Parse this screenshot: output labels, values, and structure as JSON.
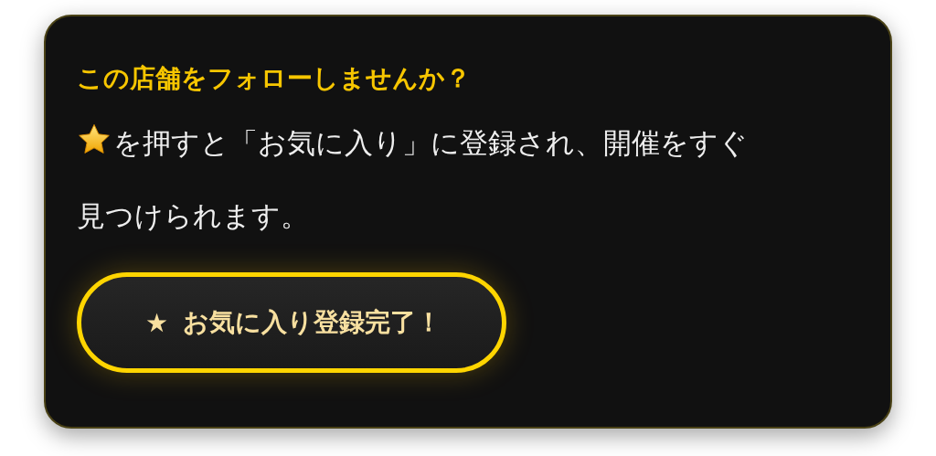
{
  "card": {
    "title": "この店舗をフォローしませんか？",
    "message_lines": [
      "を押すと「お気に入り」に登録され、開催をすぐ",
      "見つけられます。"
    ],
    "button": {
      "icon": "★",
      "label": "お気に入り登録完了！"
    }
  }
}
